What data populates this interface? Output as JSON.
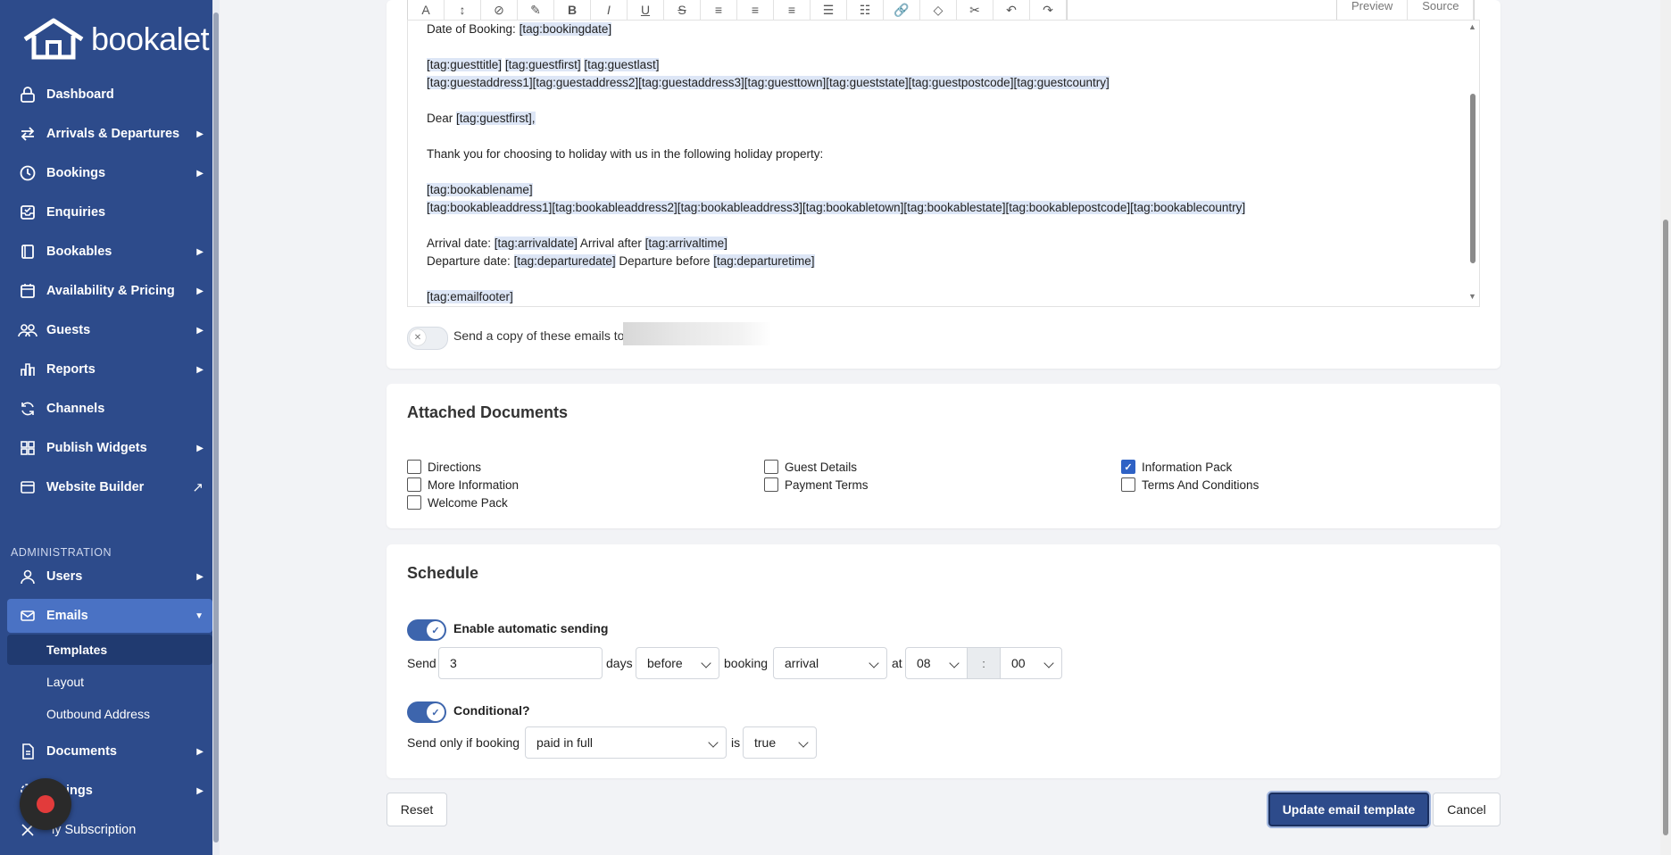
{
  "sidebar": {
    "brand": "bookalet",
    "items": [
      {
        "label": "Dashboard",
        "icon": "lock-icon",
        "arrow": ""
      },
      {
        "label": "Arrivals & Departures",
        "icon": "swap-arrows-icon",
        "arrow": "▶"
      },
      {
        "label": "Bookings",
        "icon": "clock-icon",
        "arrow": "▶"
      },
      {
        "label": "Enquiries",
        "icon": "inbox-icon",
        "arrow": ""
      },
      {
        "label": "Bookables",
        "icon": "book-icon",
        "arrow": "▶"
      },
      {
        "label": "Availability & Pricing",
        "icon": "calendar-icon",
        "arrow": "▶"
      },
      {
        "label": "Guests",
        "icon": "users-icon",
        "arrow": "▶"
      },
      {
        "label": "Reports",
        "icon": "bar-chart-icon",
        "arrow": "▶"
      },
      {
        "label": "Channels",
        "icon": "refresh-icon",
        "arrow": ""
      },
      {
        "label": "Publish Widgets",
        "icon": "grid-icon",
        "arrow": "▶"
      },
      {
        "label": "Website Builder",
        "icon": "window-icon",
        "arrow": "↗"
      }
    ],
    "admin_label": "ADMINISTRATION",
    "admin_items": [
      {
        "label": "Users",
        "icon": "user-icon",
        "arrow": "▶"
      },
      {
        "label": "Emails",
        "icon": "envelope-icon",
        "arrow": "▼"
      }
    ],
    "email_sub": [
      "Templates",
      "Layout",
      "Outbound Address"
    ],
    "bottom_items": [
      {
        "label": "Documents",
        "icon": "document-icon",
        "arrow": "▶"
      },
      {
        "label": "ings",
        "icon": "gear-icon",
        "arrow": "▶"
      },
      {
        "label": "ly Subscription",
        "icon": "subscription-icon",
        "arrow": ""
      }
    ]
  },
  "toolbar": {
    "buttons": [
      "A",
      "↕",
      "⊘",
      "✎",
      "B",
      "I",
      "U",
      "S",
      "≡",
      "≡",
      "≡",
      "☰",
      "☷",
      "🔗",
      "◇",
      "✂",
      "↶",
      "↷"
    ],
    "preview": "Preview",
    "source": "Source"
  },
  "editor": {
    "lines": [
      [
        {
          "t": "Date of Booking: ",
          "tag": false
        },
        {
          "t": "[tag:bookingdate]",
          "tag": true
        }
      ],
      [
        {
          "t": "[tag:guesttitle]",
          "tag": true
        },
        {
          "t": " ",
          "tag": false
        },
        {
          "t": "[tag:guestfirst]",
          "tag": true
        },
        {
          "t": " ",
          "tag": false
        },
        {
          "t": "[tag:guestlast]",
          "tag": true
        }
      ],
      [
        {
          "t": "[tag:guestaddress1][tag:guestaddress2][tag:guestaddress3][tag:guesttown][tag:gueststate][tag:guestpostcode][tag:guestcountry]",
          "tag": true
        }
      ],
      [
        {
          "t": "Dear ",
          "tag": false
        },
        {
          "t": "[tag:guestfirst],",
          "tag": true
        }
      ],
      [
        {
          "t": "Thank you for choosing to holiday with us in the following holiday property:",
          "tag": false
        }
      ],
      [
        {
          "t": "[tag:bookablename]",
          "tag": true
        }
      ],
      [
        {
          "t": "[tag:bookableaddress1][tag:bookableaddress2][tag:bookableaddress3][tag:bookabletown][tag:bookablestate][tag:bookablepostcode][tag:bookablecountry]",
          "tag": true
        }
      ],
      [
        {
          "t": "Arrival date: ",
          "tag": false
        },
        {
          "t": "[tag:arrivaldate]",
          "tag": true
        },
        {
          "t": " Arrival after ",
          "tag": false
        },
        {
          "t": "[tag:arrivaltime]",
          "tag": true
        }
      ],
      [
        {
          "t": "Departure date: ",
          "tag": false
        },
        {
          "t": "[tag:departuredate]",
          "tag": true
        },
        {
          "t": " Departure before ",
          "tag": false
        },
        {
          "t": "[tag:departuretime]",
          "tag": true
        }
      ],
      [
        {
          "t": "[tag:emailfooter]",
          "tag": true
        }
      ]
    ]
  },
  "copy_toggle": {
    "label": "Send a copy of these emails to",
    "on": false
  },
  "attached": {
    "title": "Attached Documents",
    "docs": [
      {
        "label": "Directions",
        "checked": false
      },
      {
        "label": "More Information",
        "checked": false
      },
      {
        "label": "Welcome Pack",
        "checked": false
      },
      {
        "label": "Guest Details",
        "checked": false
      },
      {
        "label": "Payment Terms",
        "checked": false
      },
      {
        "label": "Information Pack",
        "checked": true
      },
      {
        "label": "Terms And Conditions",
        "checked": false
      }
    ]
  },
  "schedule": {
    "title": "Schedule",
    "auto_label": "Enable automatic sending",
    "send_label": "Send",
    "days_value": "3",
    "days_label": "days",
    "when_value": "before",
    "booking_label": "booking",
    "event_value": "arrival",
    "at_label": "at",
    "hour_value": "08",
    "colon": ":",
    "minute_value": "00",
    "conditional_label": "Conditional?",
    "only_if_label": "Send only if booking",
    "condition_value": "paid in full",
    "is_label": "is",
    "bool_value": "true"
  },
  "actions": {
    "reset": "Reset",
    "update": "Update email template",
    "cancel": "Cancel"
  }
}
